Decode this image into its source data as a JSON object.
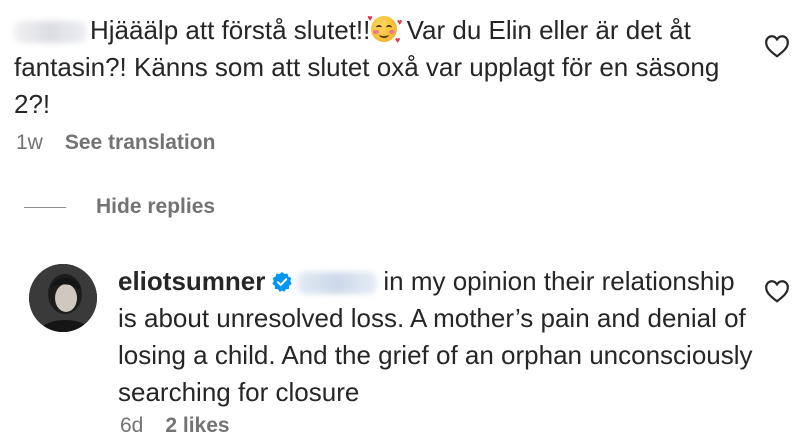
{
  "comment": {
    "text_part1": "Hjääälp att förstå slutet!!",
    "text_part2": " Var du Elin eller är det åt fantasin?! Känns som att slutet oxå var upplagt för en säsong 2?!",
    "time": "1w",
    "translate_label": "See translation"
  },
  "replies": {
    "hide_label": "Hide replies"
  },
  "reply": {
    "username": "eliotsumner",
    "text": "in my opinion their relationship is about unresolved loss. A mother’s pain and denial of losing a child. And the grief of an orphan unconsciously searching for closure",
    "time": "6d",
    "likes": "2 likes"
  },
  "icons": {
    "like": "heart-outline-icon",
    "verified": "verified-badge-icon",
    "emoji": "smiling-face-with-hearts-emoji"
  },
  "colors": {
    "text": "#262626",
    "secondary_text": "#737373",
    "verified_blue": "#0095f6"
  }
}
